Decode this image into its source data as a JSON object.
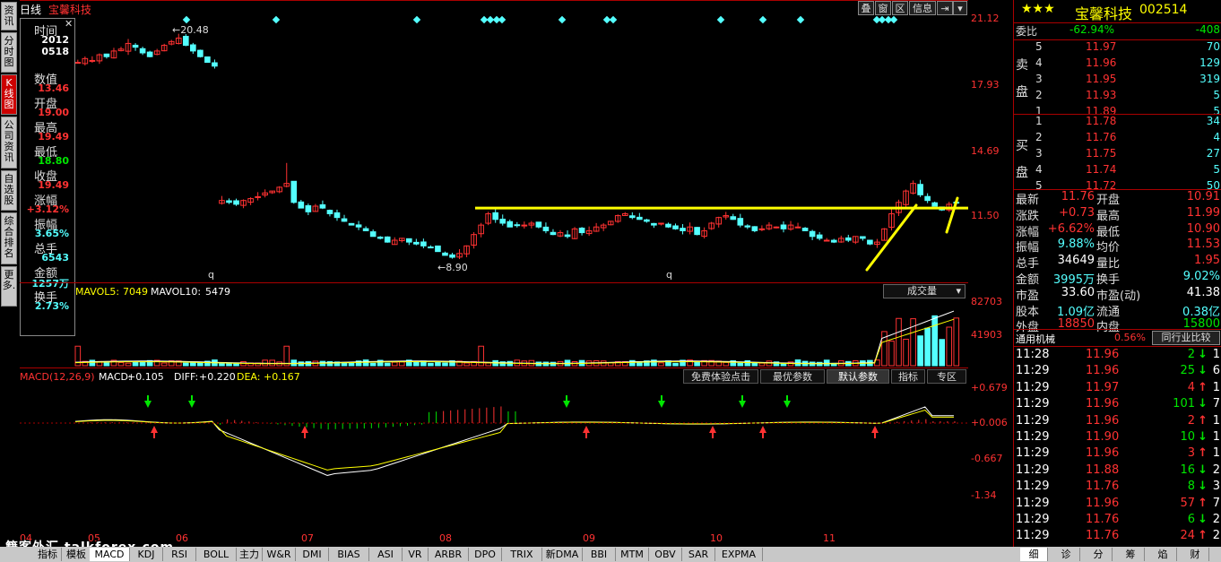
{
  "left_tabs": [
    "资讯",
    "分时图",
    "K线图",
    "公司资讯",
    "自选股",
    "综合排名",
    "更多."
  ],
  "topbar": {
    "period": "日线",
    "stock_name": "宝馨科技",
    "buttons": [
      "叠",
      "窗",
      "区",
      "信息"
    ]
  },
  "infobox": [
    {
      "label": "时间",
      "value": "2012"
    },
    {
      "label": "",
      "value": "0518"
    },
    {
      "label": "数值",
      "value": "13.46"
    },
    {
      "label": "开盘",
      "value": "19.00"
    },
    {
      "label": "最高",
      "value": "19.49"
    },
    {
      "label": "最低",
      "value": "18.80"
    },
    {
      "label": "收盘",
      "value": "19.49"
    },
    {
      "label": "涨幅",
      "value": "+3.12%"
    },
    {
      "label": "振幅",
      "value": "3.65%"
    },
    {
      "label": "总手",
      "value": "6543"
    },
    {
      "label": "金额",
      "value": "1257万"
    },
    {
      "label": "换手",
      "value": "2.73%"
    }
  ],
  "main_axis": [
    "21.12",
    "17.93",
    "14.69",
    "11.50"
  ],
  "annotations": {
    "high": "20.48",
    "low": "8.90",
    "q1": "q",
    "q2": "q"
  },
  "volume": {
    "mavol5_label": "MAVOL5:",
    "mavol5": "7049",
    "mavol10_label": "MAVOL10:",
    "mavol10": "5479",
    "selector": "成交量",
    "axis": [
      "82703",
      "41903"
    ]
  },
  "macd": {
    "title": "MACD(12,26,9)",
    "macd_label": "MACD:",
    "macd": "+0.105",
    "diff_label": "DIFF:",
    "diff": "+0.220",
    "dea_label": "DEA:",
    "dea": "+0.167",
    "axis": [
      "+0.679",
      "+0.006",
      "-0.667",
      "-1.34"
    ],
    "buttons": [
      "免费体验点击",
      "最优参数",
      "默认参数",
      "指标",
      "专区"
    ]
  },
  "x_axis": [
    "04",
    "05",
    "06",
    "07",
    "08",
    "09",
    "10",
    "11"
  ],
  "bottom_tabs": [
    "指标",
    "模板",
    "MACD",
    "KDJ",
    "RSI",
    "BOLL",
    "主力",
    "W&R",
    "DMI",
    "BIAS",
    "ASI",
    "VR",
    "ARBR",
    "DPO",
    "TRIX",
    "新DMA",
    "BBI",
    "MTM",
    "OBV",
    "SAR",
    "EXPMA"
  ],
  "watermark": "籍客外汇 talkforex.com",
  "quote": {
    "stars": "★★★",
    "name": "宝馨科技",
    "code": "002514",
    "weibi_label": "委比",
    "weibi": "-62.94%",
    "weicha": "-408",
    "sell_label": "卖盘",
    "buy_label": "买盘",
    "sell": [
      {
        "lv": "5",
        "price": "11.97",
        "vol": "70"
      },
      {
        "lv": "4",
        "price": "11.96",
        "vol": "129"
      },
      {
        "lv": "3",
        "price": "11.95",
        "vol": "319"
      },
      {
        "lv": "2",
        "price": "11.93",
        "vol": "5"
      },
      {
        "lv": "1",
        "price": "11.89",
        "vol": "5"
      }
    ],
    "buy": [
      {
        "lv": "1",
        "price": "11.78",
        "vol": "34"
      },
      {
        "lv": "2",
        "price": "11.76",
        "vol": "4"
      },
      {
        "lv": "3",
        "price": "11.75",
        "vol": "27"
      },
      {
        "lv": "4",
        "price": "11.74",
        "vol": "5"
      },
      {
        "lv": "5",
        "price": "11.72",
        "vol": "50"
      }
    ],
    "stats": [
      {
        "l1": "最新",
        "v1": "11.76",
        "l2": "开盘",
        "v2": "10.91",
        "c1": "red",
        "c2": "red"
      },
      {
        "l1": "涨跌",
        "v1": "+0.73",
        "l2": "最高",
        "v2": "11.99",
        "c1": "red",
        "c2": "red"
      },
      {
        "l1": "涨幅",
        "v1": "+6.62%",
        "l2": "最低",
        "v2": "10.90",
        "c1": "red",
        "c2": "red"
      },
      {
        "l1": "振幅",
        "v1": "9.88%",
        "l2": "均价",
        "v2": "11.53",
        "c1": "cyan",
        "c2": "red"
      },
      {
        "l1": "总手",
        "v1": "34649",
        "l2": "量比",
        "v2": "1.95",
        "c1": "white",
        "c2": "red"
      },
      {
        "l1": "金额",
        "v1": "3995万",
        "l2": "换手",
        "v2": "9.02%",
        "c1": "cyan",
        "c2": "cyan"
      },
      {
        "l1": "市盈",
        "v1": "33.60",
        "l2": "市盈(动)",
        "v2": "41.38",
        "c1": "white",
        "c2": "white"
      },
      {
        "l1": "股本",
        "v1": "1.09亿",
        "l2": "流通",
        "v2": "0.38亿",
        "c1": "cyan",
        "c2": "cyan"
      },
      {
        "l1": "外盘",
        "v1": "18850",
        "l2": "内盘",
        "v2": "15800",
        "c1": "red",
        "c2": "green"
      }
    ],
    "industry": "通用机械",
    "industry_pct": "0.56%",
    "compare_btn": "同行业比较",
    "ticks": [
      {
        "t": "11:28",
        "p": "11.96",
        "v": "2",
        "d": "down",
        "n": "1"
      },
      {
        "t": "11:29",
        "p": "11.96",
        "v": "25",
        "d": "down",
        "n": "6"
      },
      {
        "t": "11:29",
        "p": "11.97",
        "v": "4",
        "d": "up",
        "n": "1"
      },
      {
        "t": "11:29",
        "p": "11.96",
        "v": "101",
        "d": "down",
        "n": "7"
      },
      {
        "t": "11:29",
        "p": "11.96",
        "v": "2",
        "d": "up",
        "n": "1"
      },
      {
        "t": "11:29",
        "p": "11.90",
        "v": "10",
        "d": "down",
        "n": "1"
      },
      {
        "t": "11:29",
        "p": "11.96",
        "v": "3",
        "d": "up",
        "n": "1"
      },
      {
        "t": "11:29",
        "p": "11.88",
        "v": "16",
        "d": "down",
        "n": "2"
      },
      {
        "t": "11:29",
        "p": "11.76",
        "v": "8",
        "d": "down",
        "n": "3"
      },
      {
        "t": "11:29",
        "p": "11.96",
        "v": "57",
        "d": "up",
        "n": "7"
      },
      {
        "t": "11:29",
        "p": "11.76",
        "v": "6",
        "d": "down",
        "n": "2"
      },
      {
        "t": "11:29",
        "p": "11.76",
        "v": "24",
        "d": "up",
        "n": "2"
      }
    ],
    "right_tabs": [
      "细",
      "诊",
      "分",
      "筹",
      "焰",
      "财"
    ]
  },
  "chart_data": {
    "type": "candlestick",
    "support_level": 11.5,
    "ylim": [
      8.0,
      21.5
    ],
    "closes": [
      19.2,
      19.4,
      19.3,
      19.6,
      19.5,
      19.8,
      19.9,
      20.2,
      20.0,
      19.7,
      19.5,
      19.8,
      20.1,
      20.3,
      20.48,
      20.1,
      19.8,
      19.5,
      19.2,
      19.0,
      11.9,
      11.8,
      11.7,
      11.9,
      12.0,
      12.1,
      12.3,
      12.4,
      12.6,
      12.8,
      11.8,
      11.5,
      11.3,
      11.6,
      11.5,
      11.2,
      11.0,
      10.8,
      10.6,
      10.5,
      10.3,
      10.0,
      9.9,
      9.7,
      9.8,
      9.9,
      9.7,
      9.6,
      9.5,
      9.4,
      9.2,
      9.0,
      8.9,
      9.1,
      9.5,
      10.1,
      10.6,
      11.2,
      10.9,
      10.7,
      10.5,
      10.6,
      10.6,
      10.7,
      10.5,
      10.3,
      10.1,
      10.2,
      10.0,
      10.4,
      10.2,
      10.3,
      10.5,
      10.6,
      10.8,
      11.1,
      11.2,
      11.0,
      10.9,
      10.8,
      10.6,
      10.7,
      10.5,
      10.4,
      10.3,
      10.5,
      10.1,
      10.3,
      10.7,
      11.0,
      11.1,
      10.9,
      10.6,
      10.5,
      10.3,
      10.4,
      10.6,
      10.5,
      10.4,
      10.6,
      10.5,
      10.3,
      10.0,
      9.9,
      9.8,
      9.7,
      9.9,
      9.8,
      10.0,
      9.9,
      9.6,
      9.7,
      10.4,
      11.2,
      11.8,
      12.4,
      12.8,
      12.2,
      11.9,
      11.6,
      11.4,
      11.7,
      11.76
    ]
  }
}
